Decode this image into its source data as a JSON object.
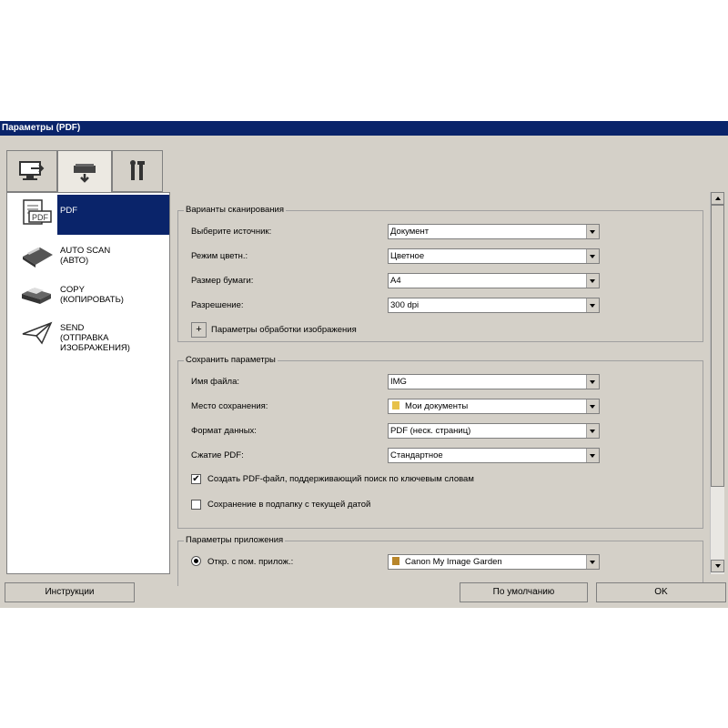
{
  "window": {
    "title": "Параметры (PDF)"
  },
  "tabs": [
    {
      "name": "scan-from-computer",
      "icon": "computer-scan-icon"
    },
    {
      "name": "scan-from-panel",
      "icon": "scanner-icon"
    },
    {
      "name": "general-settings",
      "icon": "tools-icon"
    }
  ],
  "sidebar": {
    "items": [
      {
        "label": "PDF",
        "icon": "pdf-document-icon"
      },
      {
        "label": "AUTO SCAN\n(АВТО)",
        "icon": "scanner-auto-icon"
      },
      {
        "label": "COPY\n(КОПИРОВАТЬ)",
        "icon": "printer-icon"
      },
      {
        "label": "SEND\n(ОТПРАВКА\nИЗОБРАЖЕНИЯ)",
        "icon": "send-plane-icon"
      }
    ]
  },
  "scan_options": {
    "title": "Варианты сканирования",
    "source_label": "Выберите источник:",
    "source_value": "Документ",
    "color_label": "Режим цветн.:",
    "color_value": "Цветное",
    "paper_label": "Размер бумаги:",
    "paper_value": "A4",
    "resolution_label": "Разрешение:",
    "resolution_value": "300 dpi",
    "image_processing_label": "Параметры обработки изображения",
    "plus": "+"
  },
  "save_settings": {
    "title": "Сохранить параметры",
    "filename_label": "Имя файла:",
    "filename_value": "IMG",
    "location_label": "Место сохранения:",
    "location_value": "Мои документы",
    "format_label": "Формат данных:",
    "format_value": "PDF (неск. страниц)",
    "compression_label": "Сжатие PDF:",
    "compression_value": "Стандартное",
    "searchable_label": "Создать PDF-файл, поддерживающий поиск по ключевым словам",
    "searchable_checked": true,
    "subfolder_label": "Сохранение в подпапку с текущей датой",
    "subfolder_checked": false,
    "check_mark": "✔"
  },
  "app_settings": {
    "title": "Параметры приложения",
    "open_with_label": "Откр. с пом. прилож.:",
    "open_with_value": "Canon My Image Garden"
  },
  "buttons": {
    "instructions": "Инструкции",
    "defaults": "По умолчанию",
    "ok": "OK"
  }
}
